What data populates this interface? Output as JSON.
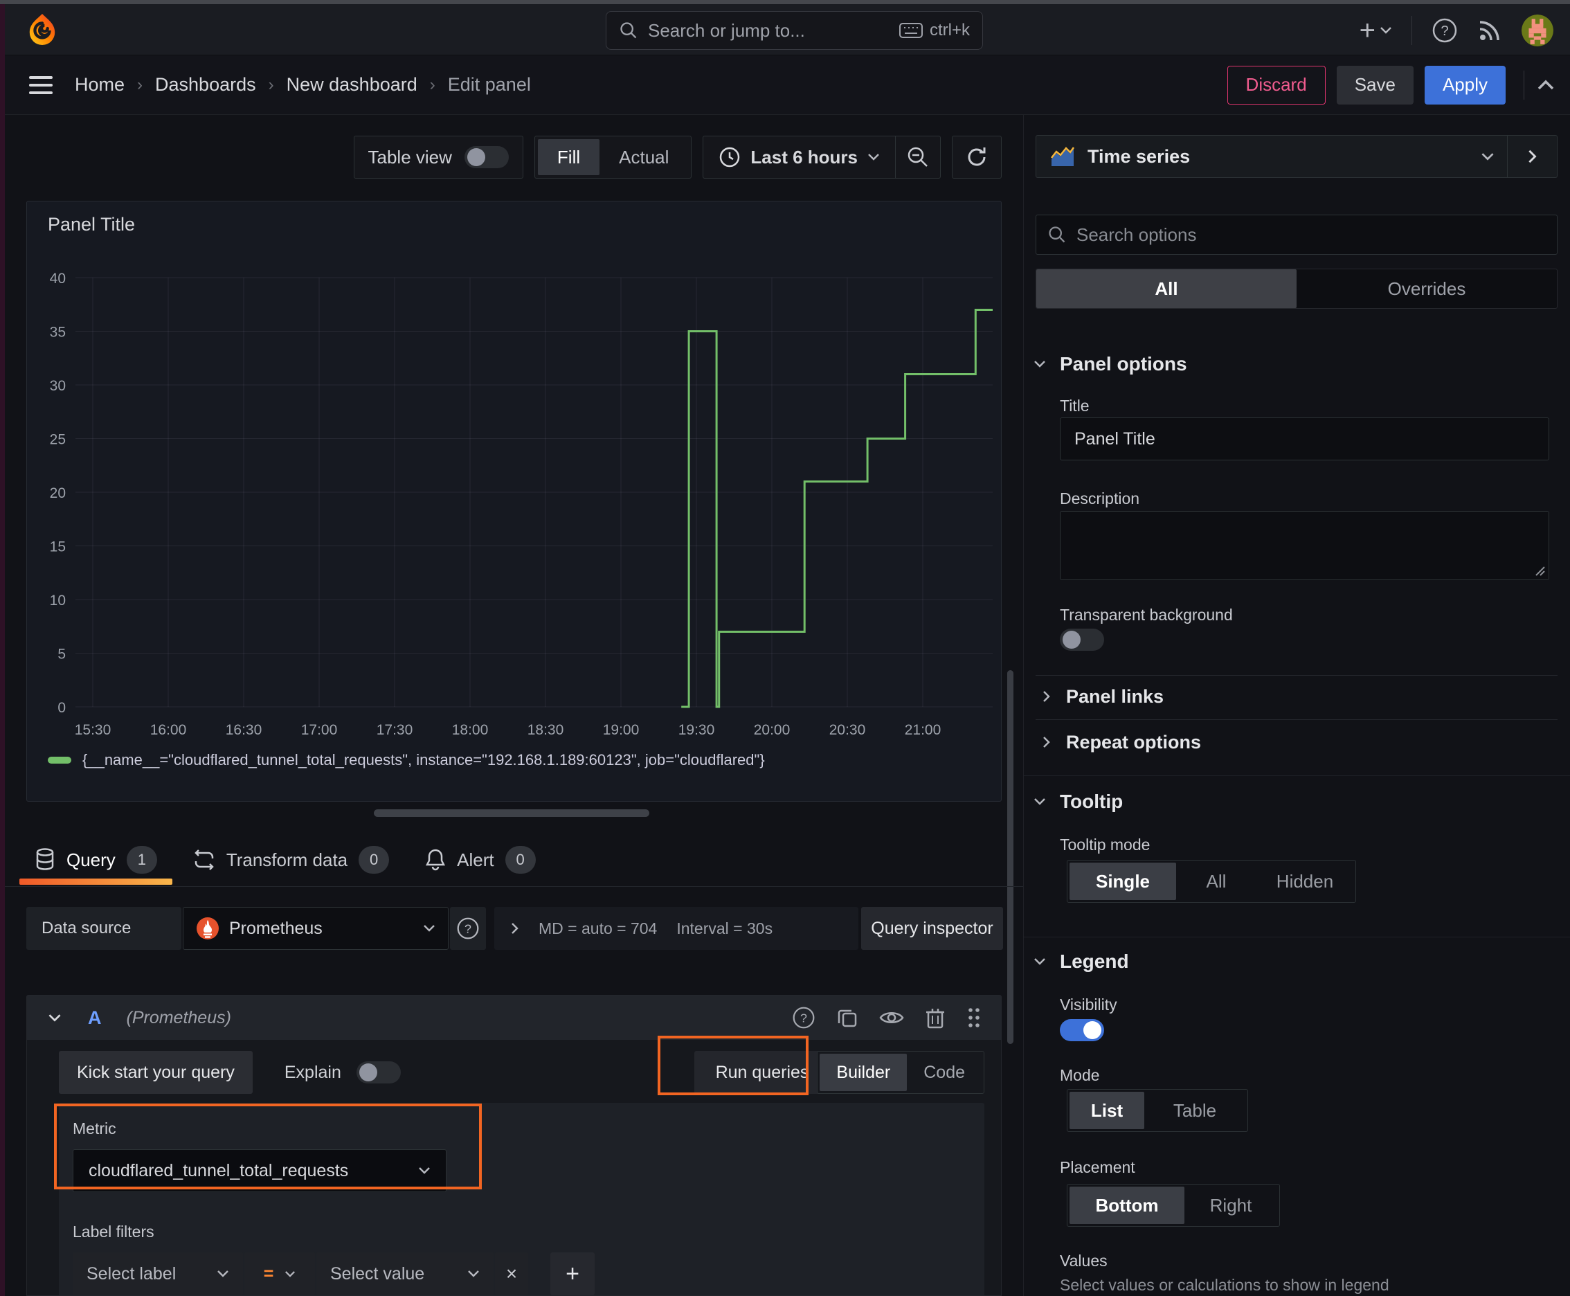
{
  "header": {
    "search_placeholder": "Search or jump to...",
    "search_shortcut": "ctrl+k"
  },
  "breadcrumb": {
    "items": [
      "Home",
      "Dashboards",
      "New dashboard",
      "Edit panel"
    ],
    "discard": "Discard",
    "save": "Save",
    "apply": "Apply"
  },
  "toolbar": {
    "table_view": "Table view",
    "fill": "Fill",
    "actual": "Actual",
    "time_range": "Last 6 hours"
  },
  "chart_data": {
    "type": "line",
    "line_style": "step-after",
    "color": "#73bf69",
    "title": "Panel Title",
    "x_ticks": [
      "15:30",
      "16:00",
      "16:30",
      "17:00",
      "17:30",
      "18:00",
      "18:30",
      "19:00",
      "19:30",
      "20:00",
      "20:30",
      "21:00"
    ],
    "y_ticks": [
      0,
      5,
      10,
      15,
      20,
      25,
      30,
      35,
      40
    ],
    "ylim": [
      0,
      40
    ],
    "grid": true,
    "points": [
      {
        "t": "19:24",
        "v": 0
      },
      {
        "t": "19:27",
        "v": 35
      },
      {
        "t": "19:38",
        "v": 0
      },
      {
        "t": "19:39",
        "v": 7
      },
      {
        "t": "20:13",
        "v": 21
      },
      {
        "t": "20:38",
        "v": 25
      },
      {
        "t": "20:53",
        "v": 31
      },
      {
        "t": "21:21",
        "v": 37
      }
    ],
    "series_label": "{__name__=\"cloudflared_tunnel_total_requests\", instance=\"192.168.1.189:60123\", job=\"cloudflared\"}",
    "legend_position": "bottom"
  },
  "tabs": {
    "query": {
      "label": "Query",
      "count": "1"
    },
    "transform": {
      "label": "Transform data",
      "count": "0"
    },
    "alert": {
      "label": "Alert",
      "count": "0"
    }
  },
  "datasource_row": {
    "label": "Data source",
    "name": "Prometheus",
    "meta_md": "MD = auto = 704",
    "meta_interval": "Interval = 30s",
    "inspector": "Query inspector"
  },
  "query": {
    "ref": "A",
    "ds_hint": "(Prometheus)",
    "kickstart": "Kick start your query",
    "explain": "Explain",
    "run": "Run queries",
    "builder": "Builder",
    "code": "Code",
    "metric_label": "Metric",
    "metric_value": "cloudflared_tunnel_total_requests",
    "filters_label": "Label filters",
    "select_label": "Select label",
    "operator": "=",
    "select_value": "Select value"
  },
  "options": {
    "viz_type": "Time series",
    "search_placeholder": "Search options",
    "tab_all": "All",
    "tab_overrides": "Overrides",
    "panel_options": {
      "header": "Panel options",
      "title_label": "Title",
      "title_value": "Panel Title",
      "description_label": "Description",
      "transparent_label": "Transparent background",
      "panel_links": "Panel links",
      "repeat_options": "Repeat options"
    },
    "tooltip": {
      "header": "Tooltip",
      "mode_label": "Tooltip mode",
      "single": "Single",
      "all": "All",
      "hidden": "Hidden"
    },
    "legend": {
      "header": "Legend",
      "visibility_label": "Visibility",
      "mode_label": "Mode",
      "list": "List",
      "table": "Table",
      "placement_label": "Placement",
      "bottom": "Bottom",
      "right": "Right",
      "values_label": "Values",
      "values_help": "Select values or calculations to show in legend"
    }
  },
  "colors": {
    "annotation_orange": "#f26522",
    "series_green": "#73bf69",
    "primary_blue": "#3d71d9",
    "discard_pink": "#e0356f",
    "tab_underline": "#f05a28"
  }
}
